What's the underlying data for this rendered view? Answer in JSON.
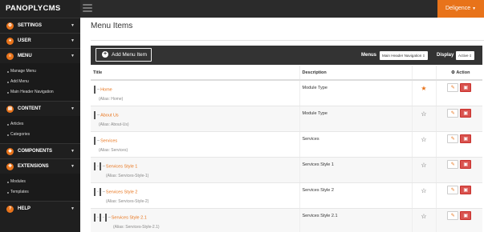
{
  "app": {
    "brand": "PANOPLYCMS",
    "user_menu": "Deligence"
  },
  "sidebar": {
    "sections": [
      {
        "label": "SETTINGS",
        "icon": "gear-icon",
        "glyph": "⚙",
        "subitems": []
      },
      {
        "label": "USER",
        "icon": "user-icon",
        "glyph": "●",
        "subitems": []
      },
      {
        "label": "MENU",
        "icon": "menu-icon",
        "glyph": "≡",
        "subitems": [
          "Manage Menu",
          "Add Menu",
          "Main Header Navigation"
        ]
      },
      {
        "label": "CONTENT",
        "icon": "content-icon",
        "glyph": "▤",
        "subitems": [
          "Articles",
          "Categories"
        ]
      },
      {
        "label": "COMPONENTS",
        "icon": "components-icon",
        "glyph": "◆",
        "subitems": []
      },
      {
        "label": "EXTENSIONS",
        "icon": "extensions-icon",
        "glyph": "✚",
        "subitems": [
          "Modules",
          "Templates"
        ]
      },
      {
        "label": "HELP",
        "icon": "help-icon",
        "glyph": "?",
        "subitems": []
      }
    ]
  },
  "main": {
    "title": "Menu Items",
    "toolbar": {
      "add_label": "Add Menu Item",
      "menus_label": "Menus",
      "menus_value": "Main Header Navigation",
      "display_label": "Display",
      "display_value": "Active"
    },
    "table": {
      "headers": [
        "Title",
        "Description",
        "",
        "Action"
      ],
      "rows": [
        {
          "depth": 0,
          "title": "Home",
          "alias": "(Alias: Home)",
          "description": "Module Type",
          "featured": true
        },
        {
          "depth": 0,
          "title": "About Us",
          "alias": "(Alias: About-Us)",
          "description": "Module Type",
          "featured": false
        },
        {
          "depth": 0,
          "title": "Services",
          "alias": "(Alias: Services)",
          "description": "Services",
          "featured": false
        },
        {
          "depth": 1,
          "title": "Services Style 1",
          "alias": "(Alias: Services-Style-1)",
          "description": "Services Style 1",
          "featured": false
        },
        {
          "depth": 1,
          "title": "Services Style 2",
          "alias": "(Alias: Services-Style-2)",
          "description": "Services Style 2",
          "featured": false
        },
        {
          "depth": 2,
          "title": "Services Style 2.1",
          "alias": "(Alias: Services-Style-2.1)",
          "description": "Services Style 2.1",
          "featured": false
        }
      ]
    }
  },
  "colors": {
    "accent": "#e8731a",
    "sidebar_bg": "#1f1f1f",
    "toolbar_bg": "#333333",
    "delete": "#d9534f"
  }
}
